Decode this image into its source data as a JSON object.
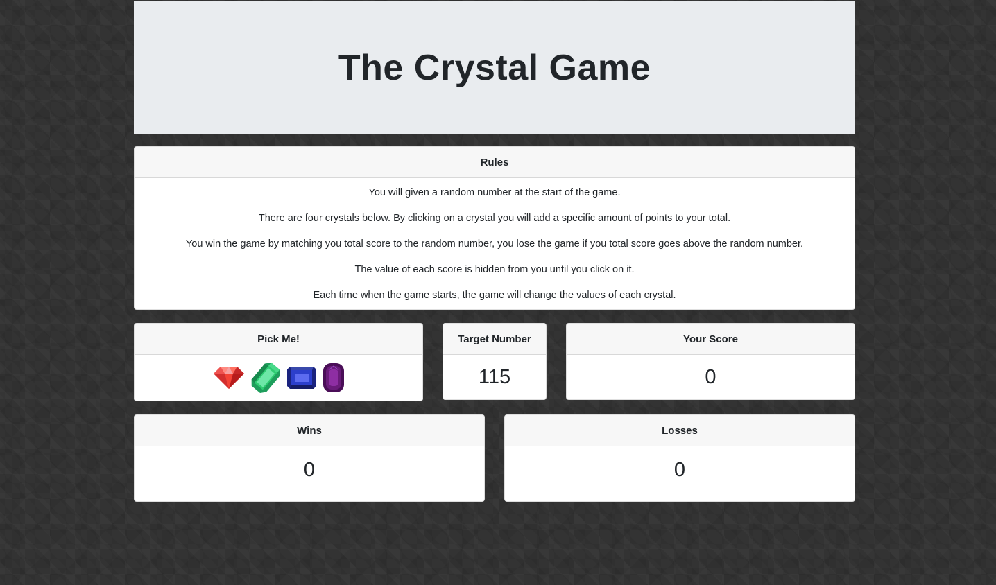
{
  "header": {
    "title": "The Crystal Game"
  },
  "rules": {
    "title": "Rules",
    "lines": [
      "You will given a random number at the start of the game.",
      "There are four crystals below. By clicking on a crystal you will add a specific amount of points to your total.",
      "You win the game by matching you total score to the random number, you lose the game if you total score goes above the random number.",
      "The value of each score is hidden from you until you click on it.",
      "Each time when the game starts, the game will change the values of each crystal."
    ]
  },
  "pick": {
    "title": "Pick Me!",
    "crystals": [
      {
        "icon": "red-gem-icon",
        "color": "#e53935"
      },
      {
        "icon": "green-gem-icon",
        "color": "#2ecc71"
      },
      {
        "icon": "blue-gem-icon",
        "color": "#2c3fcc"
      },
      {
        "icon": "purple-gem-icon",
        "color": "#6a1b7a"
      }
    ]
  },
  "target": {
    "title": "Target Number",
    "value": "115"
  },
  "score": {
    "title": "Your Score",
    "value": "0"
  },
  "wins": {
    "title": "Wins",
    "value": "0"
  },
  "losses": {
    "title": "Losses",
    "value": "0"
  }
}
